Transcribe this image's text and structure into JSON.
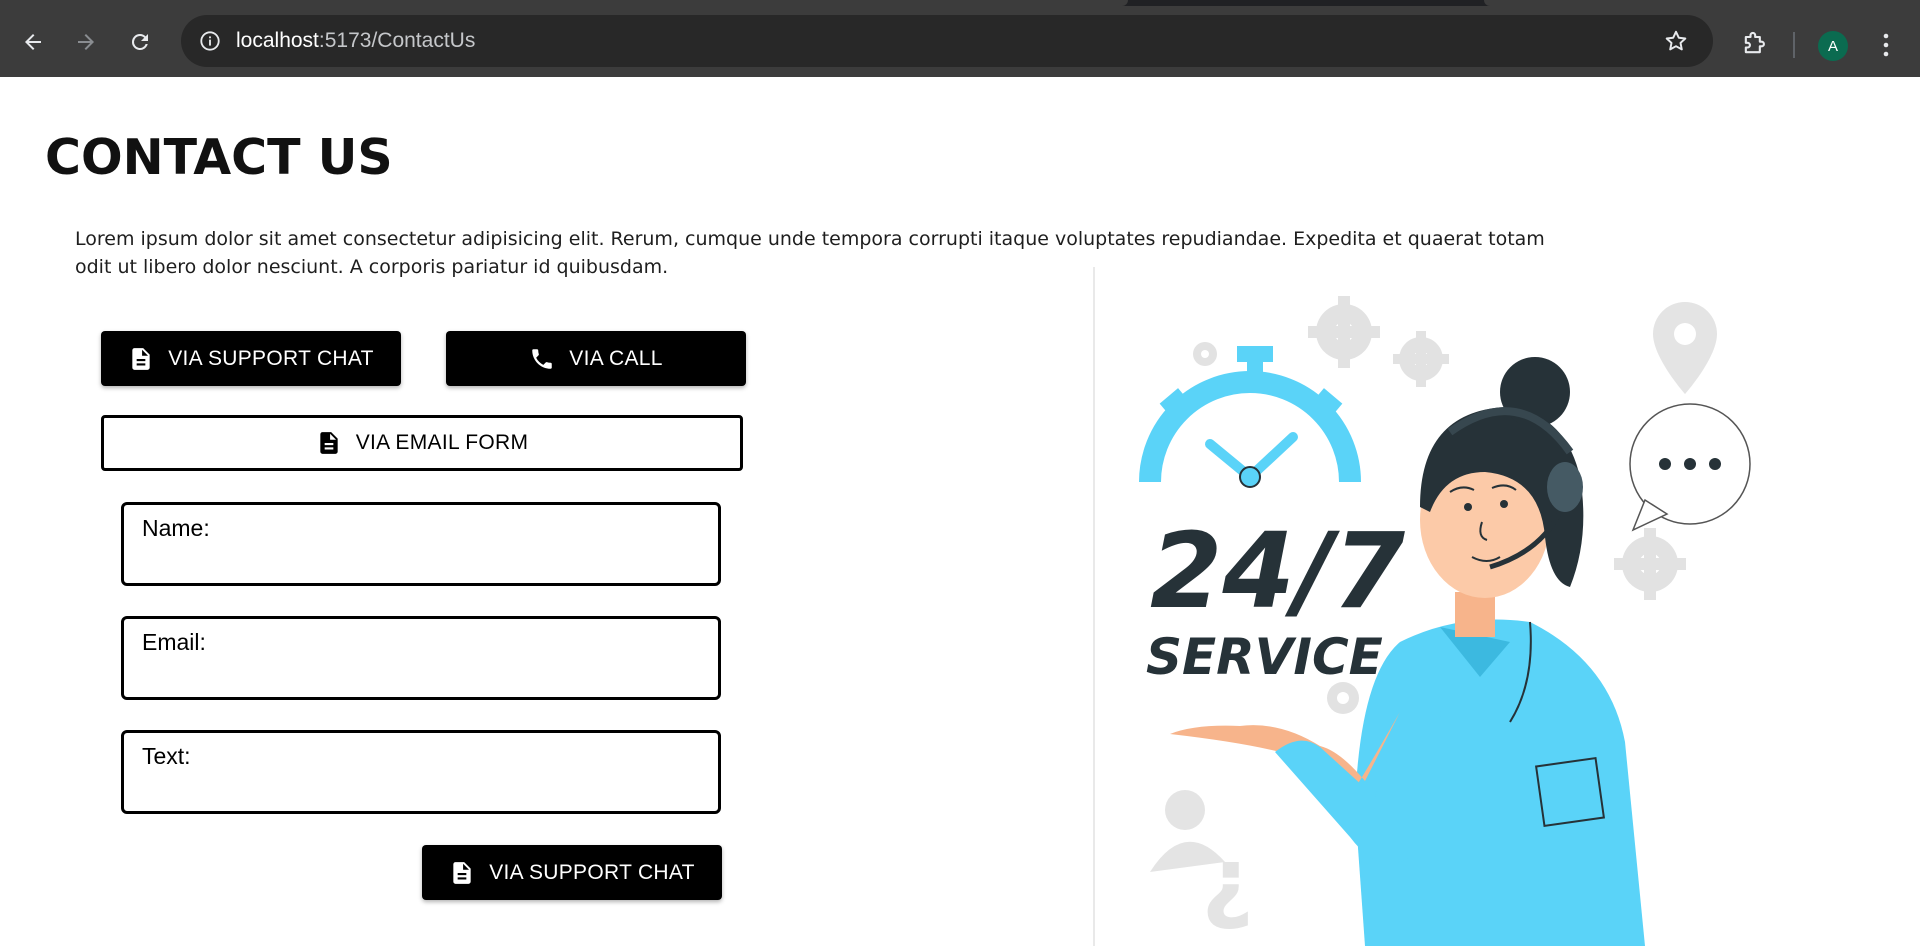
{
  "browser": {
    "url_host": "localhost",
    "url_path": ":5173/ContactUs",
    "avatar_letter": "A"
  },
  "page": {
    "title": "CONTACT US",
    "intro": "Lorem ipsum dolor sit amet consectetur adipisicing elit. Rerum, cumque unde tempora corrupti itaque voluptates repudiandae. Expedita et quaerat totam odit ut libero dolor nesciunt. A corporis pariatur id quibusdam."
  },
  "contact_options": {
    "support_chat_label": "VIA SUPPORT CHAT",
    "call_label": "VIA CALL",
    "email_form_label": "VIA EMAIL FORM"
  },
  "form": {
    "name_label": "Name:",
    "email_label": "Email:",
    "text_label": "Text:",
    "submit_label": "VIA SUPPORT CHAT"
  },
  "illustration": {
    "headline": "24/7",
    "subheadline": "SERVICE"
  },
  "colors": {
    "accent_blue": "#5ad3f8",
    "dark_ink": "#263238",
    "button_dark": "#000000"
  },
  "icons": [
    "back-arrow-icon",
    "forward-arrow-icon",
    "reload-icon",
    "info-icon",
    "star-icon",
    "extensions-icon",
    "more-vert-icon",
    "document-icon",
    "phone-icon"
  ]
}
